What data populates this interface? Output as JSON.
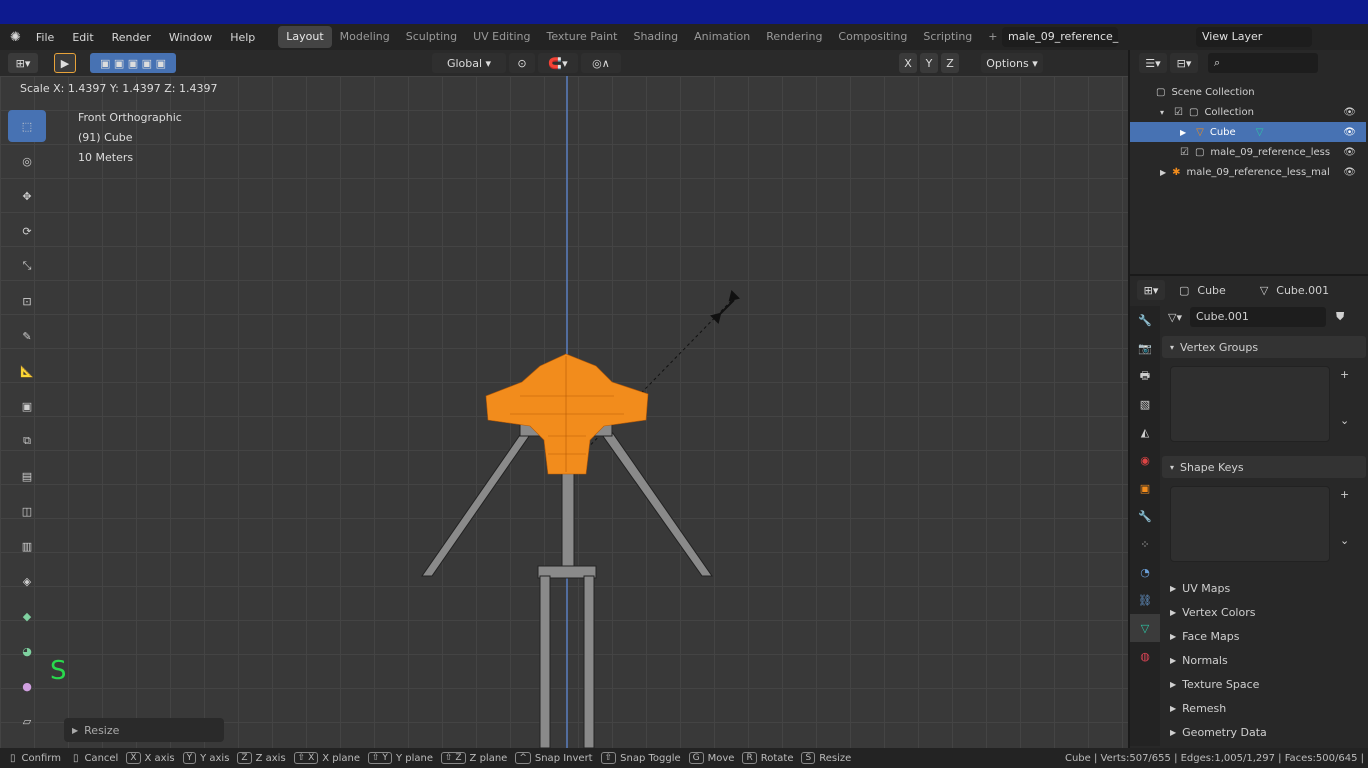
{
  "menu": [
    "File",
    "Edit",
    "Render",
    "Window",
    "Help"
  ],
  "workspaces": [
    "Layout",
    "Modeling",
    "Sculpting",
    "UV Editing",
    "Texture Paint",
    "Shading",
    "Animation",
    "Rendering",
    "Compositing",
    "Scripting"
  ],
  "active_workspace": "Layout",
  "scene_name": "male_09_reference_",
  "view_layer": "View Layer",
  "header": {
    "transform_orientation": "Global",
    "options": "Options",
    "axis_x": "X",
    "axis_y": "Y",
    "axis_z": "Z"
  },
  "viewport": {
    "scale_readout": "Scale X: 1.4397   Y: 1.4397   Z: 1.4397",
    "view_name": "Front Orthographic",
    "object_info": "(91) Cube",
    "scale_info": "10 Meters",
    "key_hint": "S",
    "last_op": "Resize"
  },
  "outliner": {
    "rows": [
      {
        "label": "Scene Collection",
        "indent": 0
      },
      {
        "label": "Collection",
        "indent": 1
      },
      {
        "label": "Cube",
        "indent": 2
      },
      {
        "label": "male_09_reference_less",
        "indent": 1
      },
      {
        "label": "male_09_reference_less_mal",
        "indent": 1
      }
    ]
  },
  "properties": {
    "object_name": "Cube",
    "mesh_name": "Cube.001",
    "datablock": "Cube.001",
    "panels": {
      "vertex_groups": "Vertex Groups",
      "shape_keys": "Shape Keys",
      "collapsed": [
        "UV Maps",
        "Vertex Colors",
        "Face Maps",
        "Normals",
        "Texture Space",
        "Remesh",
        "Geometry Data"
      ]
    }
  },
  "status": {
    "items": [
      {
        "key": "",
        "label": "Confirm"
      },
      {
        "key": "",
        "label": "Cancel"
      },
      {
        "key": "X",
        "label": "X axis"
      },
      {
        "key": "Y",
        "label": "Y axis"
      },
      {
        "key": "Z",
        "label": "Z axis"
      },
      {
        "key": "⇧ X",
        "label": "X plane"
      },
      {
        "key": "⇧ Y",
        "label": "Y plane"
      },
      {
        "key": "⇧ Z",
        "label": "Z plane"
      },
      {
        "key": "^",
        "label": "Snap Invert"
      },
      {
        "key": "⇧",
        "label": "Snap Toggle"
      },
      {
        "key": "G",
        "label": "Move"
      },
      {
        "key": "R",
        "label": "Rotate"
      },
      {
        "key": "S",
        "label": "Resize"
      }
    ],
    "stats": "Cube | Verts:507/655 | Edges:1,005/1,297 | Faces:500/645 |"
  },
  "colors": {
    "selection": "#f28c1c",
    "accent": "#4772b3",
    "key_hint": "#29d94d"
  }
}
